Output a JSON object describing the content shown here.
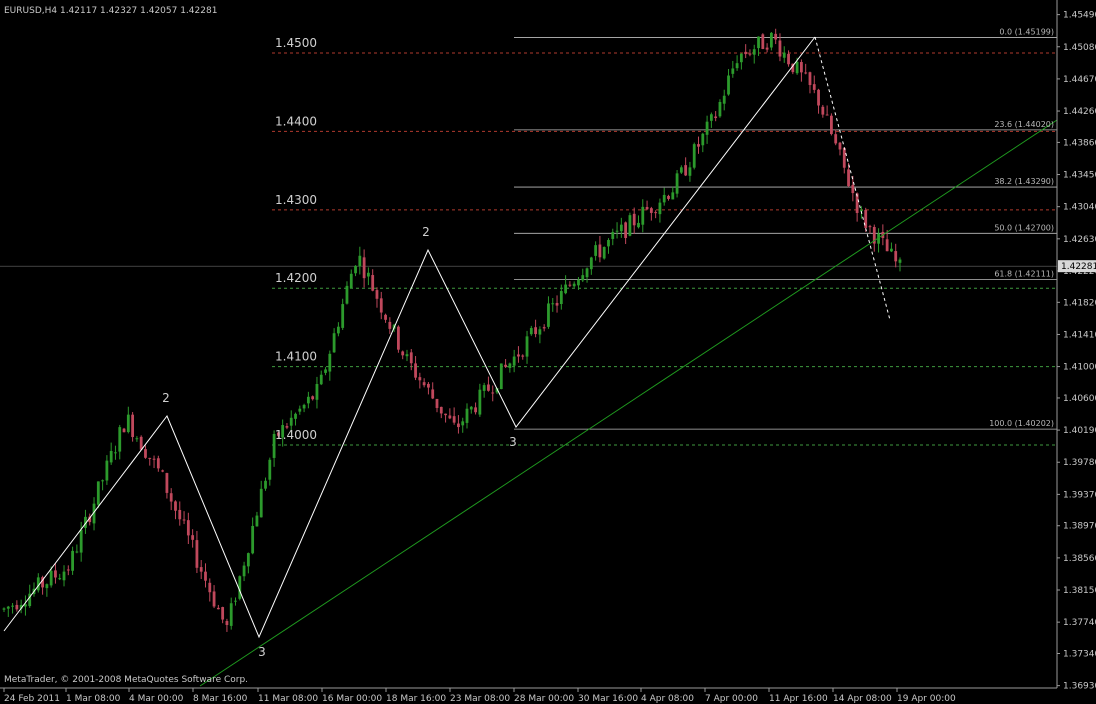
{
  "chart_data": {
    "type": "candlestick",
    "symbol_header": "EURUSD,H4  1.42117 1.42327 1.42057 1.42281",
    "copyright": "MetaTrader, © 2001-2008 MetaQuotes Software Corp.",
    "ylim": [
      1.369,
      1.456
    ],
    "y_ticks": [
      "1.45490",
      "1.45080",
      "1.44670",
      "1.44260",
      "1.43860",
      "1.43450",
      "1.43040",
      "1.42630",
      "1.42220",
      "1.41820",
      "1.41410",
      "1.41000",
      "1.40600",
      "1.40190",
      "1.39780",
      "1.39370",
      "1.38970",
      "1.38560",
      "1.38150",
      "1.37740",
      "1.37340",
      "1.36930"
    ],
    "current_price_label": "1.42281",
    "current_price": 1.42281,
    "x_ticks": [
      "24 Feb 2011",
      "1 Mar 08:00",
      "4 Mar 00:00",
      "8 Mar 16:00",
      "11 Mar 08:00",
      "16 Mar 00:00",
      "18 Mar 16:00",
      "23 Mar 08:00",
      "28 Mar 00:00",
      "30 Mar 16:00",
      "4 Apr 08:00",
      "7 Apr 00:00",
      "11 Apr 16:00",
      "14 Apr 08:00",
      "19 Apr 00:00"
    ],
    "horizontal_levels": [
      {
        "label": "1.4500",
        "value": 1.45,
        "color": "#b03a2e"
      },
      {
        "label": "1.4400",
        "value": 1.44,
        "color": "#b03a2e"
      },
      {
        "label": "1.4300",
        "value": 1.43,
        "color": "#b03a2e"
      },
      {
        "label": "1.4200",
        "value": 1.42,
        "color": "#3f9a3f"
      },
      {
        "label": "1.4100",
        "value": 1.41,
        "color": "#3f9a3f"
      },
      {
        "label": "1.4000",
        "value": 1.4,
        "color": "#3f9a3f"
      }
    ],
    "fibonacci": [
      {
        "label": "0.0 (1.45199)",
        "value": 1.45199
      },
      {
        "label": "23.6 (1.44020)",
        "value": 1.4402
      },
      {
        "label": "38.2 (1.43290)",
        "value": 1.4329
      },
      {
        "label": "50.0 (1.42700)",
        "value": 1.427
      },
      {
        "label": "61.8 (1.42111)",
        "value": 1.42111
      },
      {
        "label": "100.0 (1.40202)",
        "value": 1.40202
      }
    ],
    "wave_labels": [
      "2",
      "3",
      "2",
      "3"
    ],
    "candles_count": 210,
    "colors": {
      "background": "#000000",
      "bull": "#2c9a2c",
      "bear": "#c0485c",
      "grid_text": "#c8c8c8",
      "trendline": "#1f9a1f",
      "zigzag": "#ffffff"
    }
  }
}
